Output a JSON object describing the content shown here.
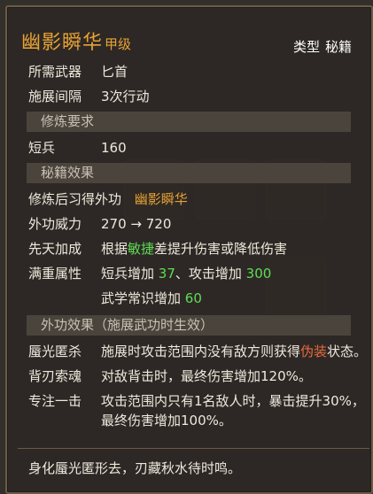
{
  "skill": {
    "name": "幽影瞬华",
    "grade": "甲级",
    "type_label": "类型",
    "type_value": "秘籍"
  },
  "stats": [
    {
      "label": "所需武器",
      "value": "匕首"
    },
    {
      "label": "施展间隔",
      "value": "3次行动"
    }
  ],
  "requirements": {
    "header": "修炼要求",
    "items": [
      {
        "label": "短兵",
        "value": "160"
      }
    ]
  },
  "effects": {
    "header": "秘籍效果",
    "learn_label": "修炼后习得外功",
    "learn_value": "幽影瞬华",
    "power_label": "外功威力",
    "power_value": "270 → 720",
    "innate_label": "先天加成",
    "innate_pre": "根据",
    "innate_attr": "敏捷",
    "innate_post": "差提升伤害或降低伤害",
    "full_label": "满重属性",
    "full_line1_a": "短兵增加 ",
    "full_line1_b": "37",
    "full_line1_c": "、攻击增加 ",
    "full_line1_d": "300",
    "full_line2_a": "武学常识增加 ",
    "full_line2_b": "60"
  },
  "external": {
    "header": "外功效果（施展武功时生效）",
    "items": [
      {
        "label": "蜃光匿杀",
        "text_pre": "施展时攻击范围内没有敌方则获得",
        "text_hl": "伪装",
        "text_post": "状态。"
      },
      {
        "label": "背刃索魂",
        "text": "对敌背击时，最终伤害增加120%。"
      },
      {
        "label": "专注一击",
        "line1": "攻击范围内只有1名敌人时，暴击提升30%，",
        "line2": "最终伤害增加100%。"
      }
    ]
  },
  "flavor": "身化蜃光匿形去，刃藏秋水待时鸣。",
  "colors": {
    "gold": "#e7a235",
    "green": "#5fdc55",
    "red": "#e76b3d"
  }
}
